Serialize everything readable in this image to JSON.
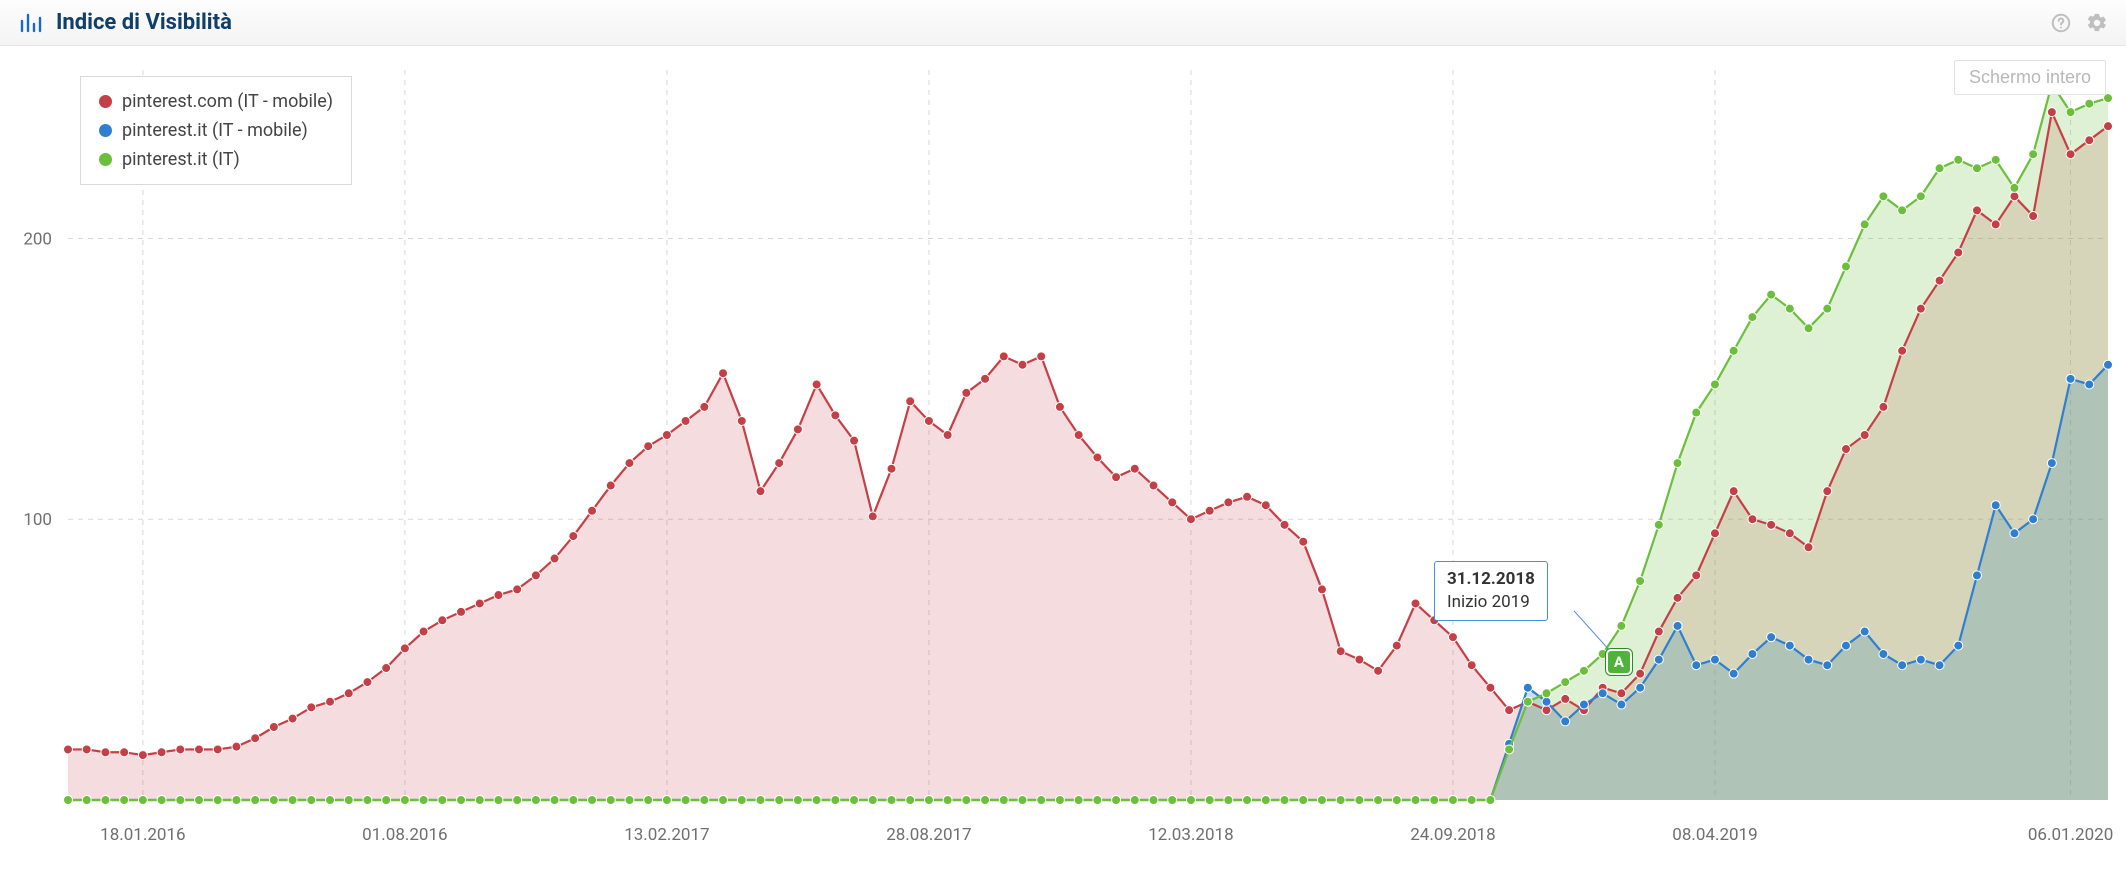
{
  "header": {
    "title": "Indice di Visibilità"
  },
  "buttons": {
    "fullscreen": "Schermo intero"
  },
  "legend": [
    {
      "color": "#c63f46",
      "label": "pinterest.com (IT - mobile)"
    },
    {
      "color": "#2f7fd1",
      "label": "pinterest.it (IT - mobile)"
    },
    {
      "color": "#6bbf3a",
      "label": "pinterest.it (IT)"
    }
  ],
  "annotation": {
    "date": "31.12.2018",
    "label": "Inizio 2019",
    "marker": "A"
  },
  "chart_data": {
    "type": "area",
    "xlabel": "",
    "ylabel": "",
    "ylim": [
      0,
      260
    ],
    "yticks": [
      100,
      200
    ],
    "x_tick_labels": [
      "18.01.2016",
      "01.08.2016",
      "13.02.2017",
      "28.08.2017",
      "12.03.2018",
      "24.09.2018",
      "08.04.2019",
      "06.01.2020"
    ],
    "x_tick_indices": [
      4,
      18,
      32,
      46,
      60,
      74,
      88,
      107
    ],
    "annotation_index": 81,
    "n_points": 110,
    "series": [
      {
        "name": "pinterest.com (IT - mobile)",
        "color": "#c63f46",
        "fill": "rgba(198,63,70,0.18)",
        "values": [
          18,
          18,
          17,
          17,
          16,
          17,
          18,
          18,
          18,
          19,
          22,
          26,
          29,
          33,
          35,
          38,
          42,
          47,
          54,
          60,
          64,
          67,
          70,
          73,
          75,
          80,
          86,
          94,
          103,
          112,
          120,
          126,
          130,
          135,
          140,
          152,
          135,
          110,
          120,
          132,
          148,
          137,
          128,
          101,
          118,
          142,
          135,
          130,
          145,
          150,
          158,
          155,
          158,
          140,
          130,
          122,
          115,
          118,
          112,
          106,
          100,
          103,
          106,
          108,
          105,
          98,
          92,
          75,
          53,
          50,
          46,
          55,
          70,
          64,
          58,
          48,
          40,
          32,
          35,
          32,
          36,
          32,
          40,
          38,
          45,
          60,
          72,
          80,
          95,
          110,
          100,
          98,
          95,
          90,
          110,
          125,
          130,
          140,
          160,
          175,
          185,
          195,
          210,
          205,
          215,
          208,
          245,
          230,
          235,
          240
        ]
      },
      {
        "name": "pinterest.it (IT - mobile)",
        "color": "#2f7fd1",
        "fill": "rgba(47,127,209,0.25)",
        "values": [
          0,
          0,
          0,
          0,
          0,
          0,
          0,
          0,
          0,
          0,
          0,
          0,
          0,
          0,
          0,
          0,
          0,
          0,
          0,
          0,
          0,
          0,
          0,
          0,
          0,
          0,
          0,
          0,
          0,
          0,
          0,
          0,
          0,
          0,
          0,
          0,
          0,
          0,
          0,
          0,
          0,
          0,
          0,
          0,
          0,
          0,
          0,
          0,
          0,
          0,
          0,
          0,
          0,
          0,
          0,
          0,
          0,
          0,
          0,
          0,
          0,
          0,
          0,
          0,
          0,
          0,
          0,
          0,
          0,
          0,
          0,
          0,
          0,
          0,
          0,
          0,
          0,
          20,
          40,
          35,
          28,
          34,
          38,
          34,
          40,
          50,
          62,
          48,
          50,
          45,
          52,
          58,
          55,
          50,
          48,
          55,
          60,
          52,
          48,
          50,
          48,
          55,
          80,
          105,
          95,
          100,
          120,
          150,
          148,
          155
        ]
      },
      {
        "name": "pinterest.it (IT)",
        "color": "#6bbf3a",
        "fill": "rgba(107,191,58,0.22)",
        "values": [
          0,
          0,
          0,
          0,
          0,
          0,
          0,
          0,
          0,
          0,
          0,
          0,
          0,
          0,
          0,
          0,
          0,
          0,
          0,
          0,
          0,
          0,
          0,
          0,
          0,
          0,
          0,
          0,
          0,
          0,
          0,
          0,
          0,
          0,
          0,
          0,
          0,
          0,
          0,
          0,
          0,
          0,
          0,
          0,
          0,
          0,
          0,
          0,
          0,
          0,
          0,
          0,
          0,
          0,
          0,
          0,
          0,
          0,
          0,
          0,
          0,
          0,
          0,
          0,
          0,
          0,
          0,
          0,
          0,
          0,
          0,
          0,
          0,
          0,
          0,
          0,
          0,
          18,
          35,
          38,
          42,
          46,
          52,
          62,
          78,
          98,
          120,
          138,
          148,
          160,
          172,
          180,
          175,
          168,
          175,
          190,
          205,
          215,
          210,
          215,
          225,
          228,
          225,
          228,
          218,
          230,
          255,
          245,
          248,
          250
        ]
      }
    ]
  }
}
